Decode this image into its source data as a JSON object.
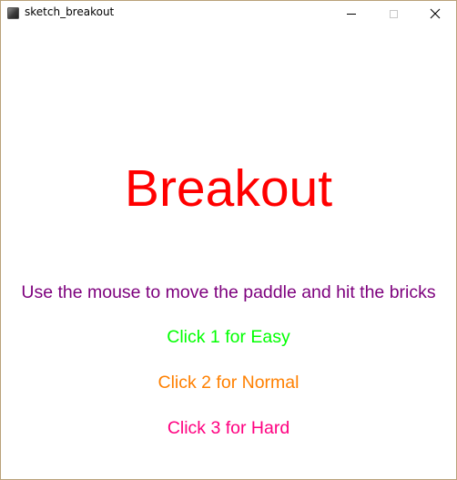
{
  "window": {
    "title": "sketch_breakout",
    "icon": "processing-sketch-icon"
  },
  "screen": {
    "title": "Breakout",
    "instructions": "Use the mouse to move the paddle and hit the bricks",
    "options": [
      {
        "label": "Click 1 for Easy",
        "color": "#00ff00"
      },
      {
        "label": "Click 2 for Normal",
        "color": "#ff8000"
      },
      {
        "label": "Click 3 for Hard",
        "color": "#ff0080"
      }
    ]
  },
  "colors": {
    "title": "#ff0000",
    "instructions": "#7d007d",
    "background": "#ffffff"
  }
}
